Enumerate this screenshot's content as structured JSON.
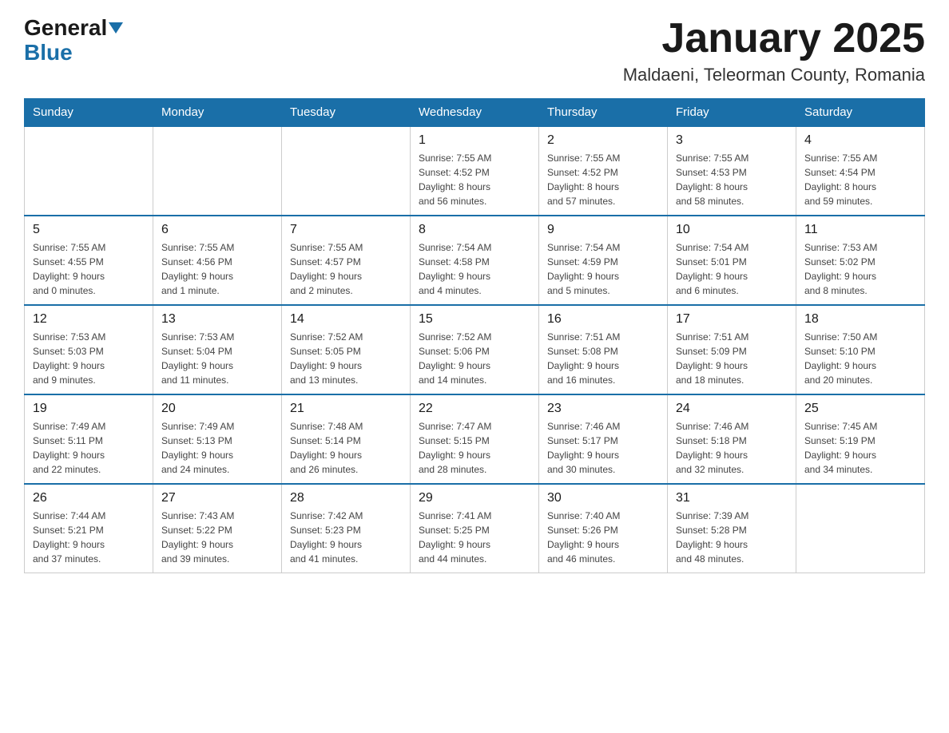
{
  "header": {
    "logo_general": "General",
    "logo_blue": "Blue",
    "title": "January 2025",
    "subtitle": "Maldaeni, Teleorman County, Romania"
  },
  "days_of_week": [
    "Sunday",
    "Monday",
    "Tuesday",
    "Wednesday",
    "Thursday",
    "Friday",
    "Saturday"
  ],
  "weeks": [
    {
      "days": [
        {
          "num": "",
          "info": ""
        },
        {
          "num": "",
          "info": ""
        },
        {
          "num": "",
          "info": ""
        },
        {
          "num": "1",
          "info": "Sunrise: 7:55 AM\nSunset: 4:52 PM\nDaylight: 8 hours\nand 56 minutes."
        },
        {
          "num": "2",
          "info": "Sunrise: 7:55 AM\nSunset: 4:52 PM\nDaylight: 8 hours\nand 57 minutes."
        },
        {
          "num": "3",
          "info": "Sunrise: 7:55 AM\nSunset: 4:53 PM\nDaylight: 8 hours\nand 58 minutes."
        },
        {
          "num": "4",
          "info": "Sunrise: 7:55 AM\nSunset: 4:54 PM\nDaylight: 8 hours\nand 59 minutes."
        }
      ]
    },
    {
      "days": [
        {
          "num": "5",
          "info": "Sunrise: 7:55 AM\nSunset: 4:55 PM\nDaylight: 9 hours\nand 0 minutes."
        },
        {
          "num": "6",
          "info": "Sunrise: 7:55 AM\nSunset: 4:56 PM\nDaylight: 9 hours\nand 1 minute."
        },
        {
          "num": "7",
          "info": "Sunrise: 7:55 AM\nSunset: 4:57 PM\nDaylight: 9 hours\nand 2 minutes."
        },
        {
          "num": "8",
          "info": "Sunrise: 7:54 AM\nSunset: 4:58 PM\nDaylight: 9 hours\nand 4 minutes."
        },
        {
          "num": "9",
          "info": "Sunrise: 7:54 AM\nSunset: 4:59 PM\nDaylight: 9 hours\nand 5 minutes."
        },
        {
          "num": "10",
          "info": "Sunrise: 7:54 AM\nSunset: 5:01 PM\nDaylight: 9 hours\nand 6 minutes."
        },
        {
          "num": "11",
          "info": "Sunrise: 7:53 AM\nSunset: 5:02 PM\nDaylight: 9 hours\nand 8 minutes."
        }
      ]
    },
    {
      "days": [
        {
          "num": "12",
          "info": "Sunrise: 7:53 AM\nSunset: 5:03 PM\nDaylight: 9 hours\nand 9 minutes."
        },
        {
          "num": "13",
          "info": "Sunrise: 7:53 AM\nSunset: 5:04 PM\nDaylight: 9 hours\nand 11 minutes."
        },
        {
          "num": "14",
          "info": "Sunrise: 7:52 AM\nSunset: 5:05 PM\nDaylight: 9 hours\nand 13 minutes."
        },
        {
          "num": "15",
          "info": "Sunrise: 7:52 AM\nSunset: 5:06 PM\nDaylight: 9 hours\nand 14 minutes."
        },
        {
          "num": "16",
          "info": "Sunrise: 7:51 AM\nSunset: 5:08 PM\nDaylight: 9 hours\nand 16 minutes."
        },
        {
          "num": "17",
          "info": "Sunrise: 7:51 AM\nSunset: 5:09 PM\nDaylight: 9 hours\nand 18 minutes."
        },
        {
          "num": "18",
          "info": "Sunrise: 7:50 AM\nSunset: 5:10 PM\nDaylight: 9 hours\nand 20 minutes."
        }
      ]
    },
    {
      "days": [
        {
          "num": "19",
          "info": "Sunrise: 7:49 AM\nSunset: 5:11 PM\nDaylight: 9 hours\nand 22 minutes."
        },
        {
          "num": "20",
          "info": "Sunrise: 7:49 AM\nSunset: 5:13 PM\nDaylight: 9 hours\nand 24 minutes."
        },
        {
          "num": "21",
          "info": "Sunrise: 7:48 AM\nSunset: 5:14 PM\nDaylight: 9 hours\nand 26 minutes."
        },
        {
          "num": "22",
          "info": "Sunrise: 7:47 AM\nSunset: 5:15 PM\nDaylight: 9 hours\nand 28 minutes."
        },
        {
          "num": "23",
          "info": "Sunrise: 7:46 AM\nSunset: 5:17 PM\nDaylight: 9 hours\nand 30 minutes."
        },
        {
          "num": "24",
          "info": "Sunrise: 7:46 AM\nSunset: 5:18 PM\nDaylight: 9 hours\nand 32 minutes."
        },
        {
          "num": "25",
          "info": "Sunrise: 7:45 AM\nSunset: 5:19 PM\nDaylight: 9 hours\nand 34 minutes."
        }
      ]
    },
    {
      "days": [
        {
          "num": "26",
          "info": "Sunrise: 7:44 AM\nSunset: 5:21 PM\nDaylight: 9 hours\nand 37 minutes."
        },
        {
          "num": "27",
          "info": "Sunrise: 7:43 AM\nSunset: 5:22 PM\nDaylight: 9 hours\nand 39 minutes."
        },
        {
          "num": "28",
          "info": "Sunrise: 7:42 AM\nSunset: 5:23 PM\nDaylight: 9 hours\nand 41 minutes."
        },
        {
          "num": "29",
          "info": "Sunrise: 7:41 AM\nSunset: 5:25 PM\nDaylight: 9 hours\nand 44 minutes."
        },
        {
          "num": "30",
          "info": "Sunrise: 7:40 AM\nSunset: 5:26 PM\nDaylight: 9 hours\nand 46 minutes."
        },
        {
          "num": "31",
          "info": "Sunrise: 7:39 AM\nSunset: 5:28 PM\nDaylight: 9 hours\nand 48 minutes."
        },
        {
          "num": "",
          "info": ""
        }
      ]
    }
  ]
}
